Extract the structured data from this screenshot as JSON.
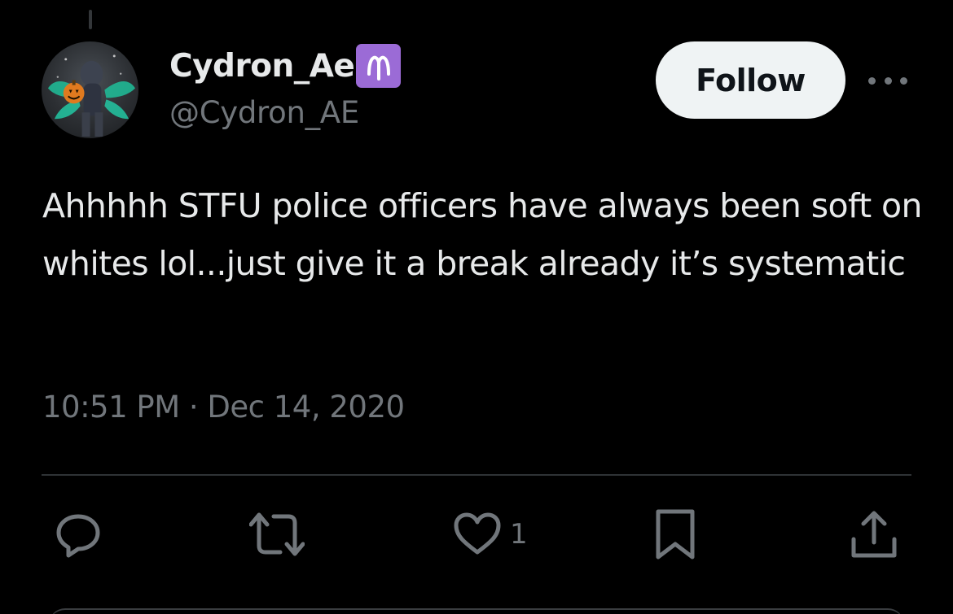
{
  "author": {
    "display_name": "Cydron_Ae",
    "badge_emoji": "♈",
    "handle": "@Cydron_AE"
  },
  "header": {
    "follow_label": "Follow",
    "more_icon": "more-horizontal-icon"
  },
  "tweet": {
    "text": "Ahhhhh STFU police officers have always been soft on whites lol...just give it a break already it’s systematic",
    "timestamp": "10:51 PM · Dec 14, 2020"
  },
  "actions": {
    "reply_icon": "reply-icon",
    "retweet_icon": "retweet-icon",
    "like_icon": "heart-icon",
    "like_count": "1",
    "bookmark_icon": "bookmark-icon",
    "share_icon": "share-icon"
  },
  "colors": {
    "background": "#000000",
    "primary_text": "#e7e9ea",
    "secondary_text": "#71767b",
    "badge": "#9b6bd6",
    "follow_button_bg": "#eff3f4"
  }
}
